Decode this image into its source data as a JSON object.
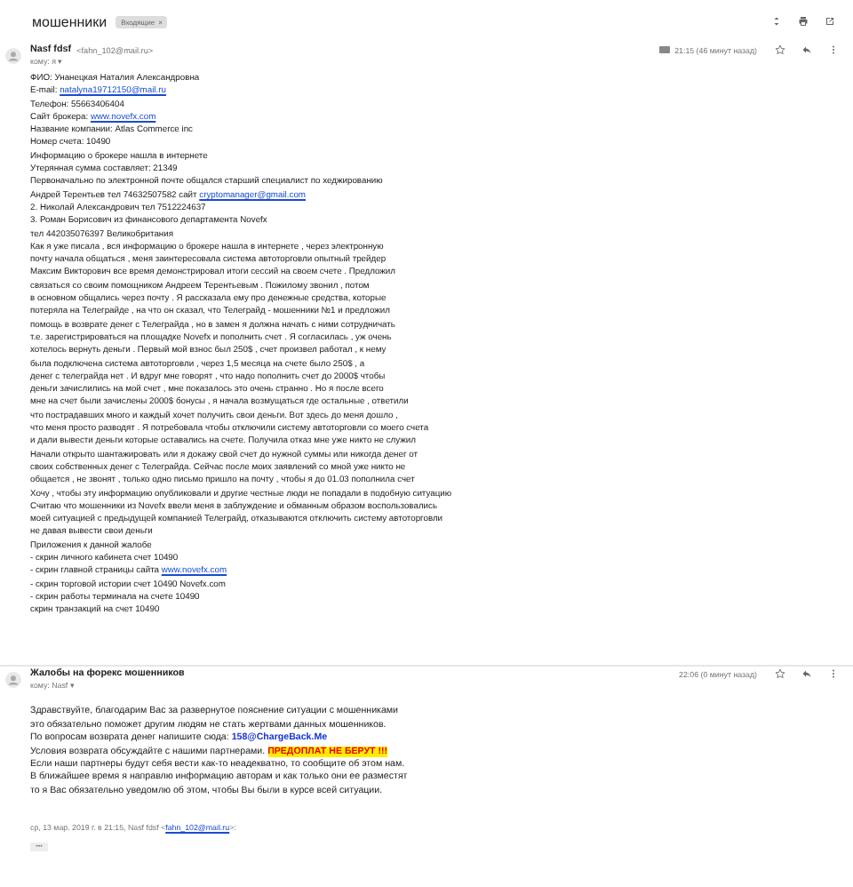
{
  "subject": "мошенники",
  "label": {
    "text": "Входящие",
    "close": "×"
  },
  "emails": [
    {
      "sender": "Nasf fdsf",
      "address": "<fahn_102@mail.ru>",
      "to": "кому: я",
      "caret": "▾",
      "time": "21:15 (46 минут назад)",
      "starred": false,
      "lines": [
        [
          {
            "kind": "plain",
            "text": "ФИО: Унанецкая Наталия Александровна"
          }
        ],
        [
          {
            "kind": "plain",
            "text": "E-mail: "
          },
          {
            "kind": "link",
            "text": "natalyna19712150@mail.ru"
          }
        ],
        [
          {
            "kind": "plain",
            "text": "Телефон: 55663406404"
          }
        ],
        [
          {
            "kind": "plain",
            "text": "Сайт брокера: "
          },
          {
            "kind": "link",
            "text": "www.novefx.com"
          }
        ],
        [
          {
            "kind": "plain",
            "text": "Название компании: Atlas Commerce inc"
          }
        ],
        [
          {
            "kind": "plain",
            "text": "Номер счета: 10490"
          }
        ],
        [
          {
            "kind": "plain",
            "text": "Информацию о брокере нашла в интернете"
          }
        ],
        [
          {
            "kind": "plain",
            "text": "Утерянная сумма составляет: 21349"
          }
        ],
        [
          {
            "kind": "plain",
            "text": "Первоначально по электронной почте общался старший специалист по хеджированию"
          }
        ],
        [
          {
            "kind": "plain",
            "text": "Андрей Терентьев тел 74632507582 сайт "
          },
          {
            "kind": "link",
            "text": "cryptomanager@gmail.com"
          }
        ],
        [
          {
            "kind": "plain",
            "text": "2. Николай Александрович тел 7512224637"
          }
        ],
        [
          {
            "kind": "plain",
            "text": "3. Роман Борисович из финансового департамента Novefx"
          }
        ],
        [
          {
            "kind": "plain",
            "text": "тел 442035076397 Великобритания"
          }
        ],
        [
          {
            "kind": "plain",
            "text": "Как я уже писала , вся информацию о брокере нашла в интернете , через электронную"
          }
        ],
        [
          {
            "kind": "plain",
            "text": "почту начала общаться , меня заинтересовала система автоторговли опытный трейдер"
          }
        ],
        [
          {
            "kind": "plain",
            "text": "Максим Викторович все время демонстрировал итоги сессий на своем счете . Предложил"
          }
        ],
        [
          {
            "kind": "plain",
            "text": "связаться со своим помощником Андреем Терентьевым . Пожилому звонил , потом"
          }
        ],
        [
          {
            "kind": "plain",
            "text": "в основном общались через почту . Я рассказала ему про денежные средства, которые"
          }
        ],
        [
          {
            "kind": "plain",
            "text": "потеряла на Телеграйде , на что он сказал, что Телеграйд - мошенники №1 и предложил"
          }
        ],
        [
          {
            "kind": "plain",
            "text": "помощь в возврате денег с Телеграйда , но в замен я должна начать с ними сотрудничать"
          }
        ],
        [
          {
            "kind": "plain",
            "text": "т.е. зарегистрироваться на площадке Novefx и пополнить счет . Я согласилась , уж очень"
          }
        ],
        [
          {
            "kind": "plain",
            "text": "хотелось вернуть деньги . Первый мой взнос был 250$ , счет произвел работал , к нему"
          }
        ],
        [
          {
            "kind": "plain",
            "text": "была подключена система автоторговли , через 1,5 месяца на счете было 250$ , а"
          }
        ],
        [
          {
            "kind": "plain",
            "text": "денег с телеграйда нет . И вдруг мне говорят , что надо пополнить счет до 2000$ чтобы"
          }
        ],
        [
          {
            "kind": "plain",
            "text": "деньги зачислились на мой счет , мне показалось это очень странно . Но я после всего"
          }
        ],
        [
          {
            "kind": "plain",
            "text": "мне на счет были зачислены 2000$ бонусы , я начала возмущаться где остальные , ответили"
          }
        ],
        [
          {
            "kind": "plain",
            "text": "что пострадавших много и каждый хочет получить свои деньги. Вот здесь до меня дошло ,"
          }
        ],
        [
          {
            "kind": "plain",
            "text": "что меня просто разводят . Я потребовала чтобы отключили систему автоторговли со моего счета"
          }
        ],
        [
          {
            "kind": "plain",
            "text": "и дали вывести деньги которые оставались на счете. Получила отказ мне уже никто не служил"
          }
        ],
        [
          {
            "kind": "plain",
            "text": "Начали открыто шантажировать или я докажу свой счет до нужной суммы или никогда денег от"
          }
        ],
        [
          {
            "kind": "plain",
            "text": "своих собственных денег с Телеграйда. Сейчас после моих заявлений со мной уже никто не"
          }
        ],
        [
          {
            "kind": "plain",
            "text": "общается , не звонят , только одно письмо пришло на почту , чтобы я до 01.03 пополнила счет"
          }
        ],
        [
          {
            "kind": "plain",
            "text": "Хочу , чтобы эту информацию опубликовали и другие честные люди не попадали в подобную ситуацию"
          }
        ],
        [
          {
            "kind": "plain",
            "text": "Считаю что мошенники из Novefx ввели меня в заблуждение и обманным образом воспользовались"
          }
        ],
        [
          {
            "kind": "plain",
            "text": "моей ситуацией с предыдущей компанией Телеграйд, отказываются отключить систему автоторговли"
          }
        ],
        [
          {
            "kind": "plain",
            "text": "не давая вывести свои деньги"
          }
        ],
        [
          {
            "kind": "plain",
            "text": "Приложения к данной жалобе"
          }
        ],
        [
          {
            "kind": "plain",
            "text": "- скрин личного кабинета счет 10490"
          }
        ],
        [
          {
            "kind": "plain",
            "text": "- скрин главной страницы сайта "
          },
          {
            "kind": "link",
            "text": "www.novefx.com"
          }
        ],
        [
          {
            "kind": "plain",
            "text": "- скрин торговой истории счет 10490 Novefx.com"
          }
        ],
        [
          {
            "kind": "plain",
            "text": "- скрин работы терминала на счете 10490"
          }
        ],
        [
          {
            "kind": "plain",
            "text": "скрин транзакций на счет 10490"
          }
        ]
      ]
    },
    {
      "sender": "Жалобы на форекс мошенников",
      "to": "кому: Nasf",
      "caret": "▾",
      "time": "22:06 (0 минут назад)",
      "starred": false,
      "lines": [
        [
          {
            "kind": "plain",
            "text": "Здравствуйте, благодарим Вас за развернутое пояснение ситуации с мошенниками"
          }
        ],
        [
          {
            "kind": "plain",
            "text": "это обязательно поможет другим людям не стать жертвами данных мошенников."
          }
        ],
        [
          {
            "kind": "plain",
            "text": "По вопросам возврата денег напишите сюда: "
          },
          {
            "kind": "strong-link",
            "text": "158@ChargeBack.Me"
          }
        ],
        [
          {
            "kind": "plain",
            "text": "Условия возврата обсуждайте с нашими партнерами. "
          },
          {
            "kind": "alert",
            "text": "ПРЕДОПЛАТ НЕ БЕРУТ !!!"
          }
        ],
        [
          {
            "kind": "plain",
            "text": "Если наши партнеры будут себя вести как-то неадекватно, то сообщите об этом нам."
          }
        ],
        [
          {
            "kind": "plain",
            "text": "В ближайшее время я направлю информацию авторам и как только они ее разместят"
          }
        ],
        [
          {
            "kind": "plain",
            "text": "то я Вас обязательно уведомлю об этом, чтобы Вы были в курсе всей ситуации."
          }
        ]
      ],
      "quote": [
        {
          "kind": "plain",
          "text": "ср, 13 мар. 2019 г. в 21:15, Nasf fdsf <"
        },
        {
          "kind": "link",
          "text": "fahn_102@mail.ru"
        },
        {
          "kind": "plain",
          "text": ">:"
        }
      ],
      "more": "•••"
    }
  ]
}
